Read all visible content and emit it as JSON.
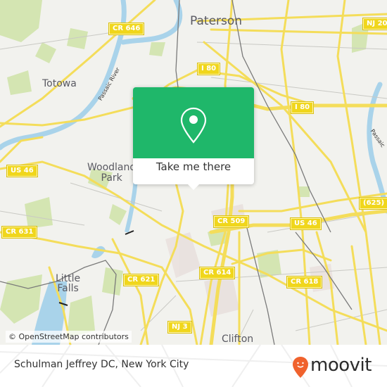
{
  "map": {
    "places": [
      {
        "id": "paterson",
        "label": "Paterson"
      },
      {
        "id": "totowa",
        "label": "Totowa"
      },
      {
        "id": "woodland-park",
        "label": "Woodland\nPark"
      },
      {
        "id": "little-falls",
        "label": "Little\nFalls"
      },
      {
        "id": "clifton",
        "label": "Clifton"
      }
    ],
    "shields": [
      {
        "id": "cr646",
        "label": "CR 646"
      },
      {
        "id": "nj20",
        "label": "NJ 20"
      },
      {
        "id": "i80-west",
        "label": "I 80"
      },
      {
        "id": "i80-east",
        "label": "I 80"
      },
      {
        "id": "us46-west",
        "label": "US 46"
      },
      {
        "id": "us46-east",
        "label": "US 46"
      },
      {
        "id": "cr625",
        "label": "(625)"
      },
      {
        "id": "cr509",
        "label": "CR 509"
      },
      {
        "id": "cr631",
        "label": "CR 631"
      },
      {
        "id": "cr621",
        "label": "CR 621"
      },
      {
        "id": "cr614",
        "label": "CR 614"
      },
      {
        "id": "cr618",
        "label": "CR 618"
      },
      {
        "id": "nj3",
        "label": "NJ 3"
      }
    ],
    "rivers": [
      {
        "id": "passaic-west",
        "label": "Passaic River"
      },
      {
        "id": "passaic-east",
        "label": "Passaic"
      }
    ],
    "attribution": "© OpenStreetMap contributors"
  },
  "popup": {
    "icon": "map-pin-icon",
    "cta_label": "Take me there",
    "accent_color": "#1fb76a"
  },
  "footer": {
    "location_title": "Schulman Jeffrey DC, New York City",
    "brand": "moovit",
    "brand_color": "#f0622d"
  }
}
